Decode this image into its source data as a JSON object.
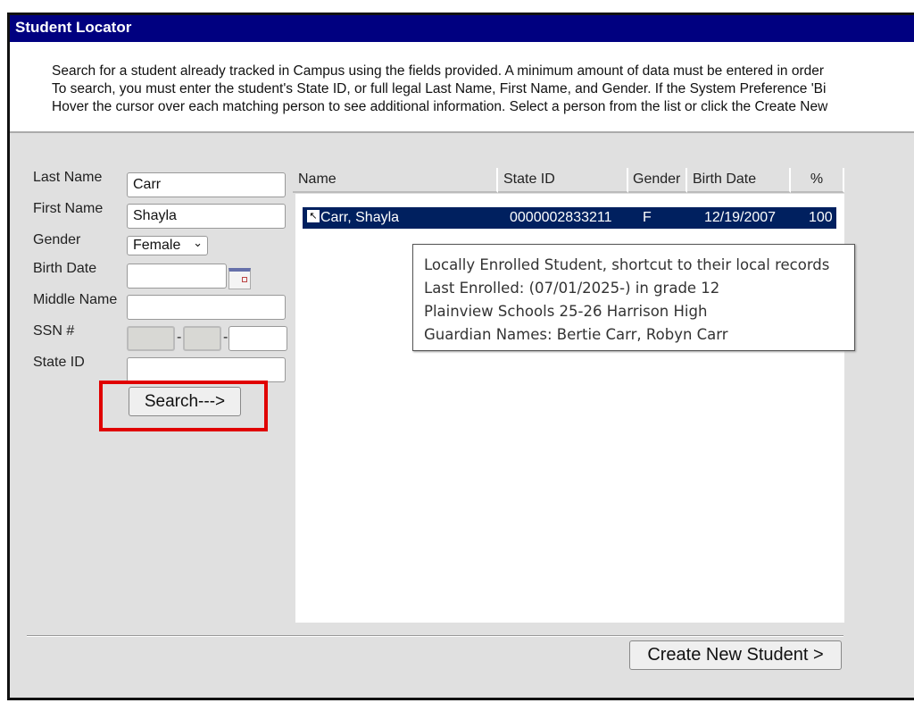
{
  "title": "Student Locator",
  "intro": [
    "Search for a student already tracked in Campus using the fields provided. A minimum amount of data must be entered in order",
    "To search, you must enter the student's State ID, or full legal Last Name, First Name, and Gender. If the System Preference 'Bi",
    "Hover the cursor over each matching person to see additional information. Select a person from the list or click the Create New"
  ],
  "form": {
    "last_name": {
      "label": "Last Name",
      "value": "Carr"
    },
    "first_name": {
      "label": "First Name",
      "value": "Shayla"
    },
    "gender": {
      "label": "Gender",
      "value": "Female"
    },
    "birth_date": {
      "label": "Birth Date",
      "value": ""
    },
    "middle_name": {
      "label": "Middle Name",
      "value": ""
    },
    "ssn": {
      "label": "SSN #",
      "sep": "-"
    },
    "state_id": {
      "label": "State ID",
      "value": ""
    },
    "search_label": "Search--->"
  },
  "results": {
    "columns": [
      "Name",
      "State ID",
      "Gender",
      "Birth Date",
      "%"
    ],
    "rows": [
      {
        "name": "Carr, Shayla",
        "state_id": "0000002833211",
        "gender": "F",
        "birth_date": "12/19/2007",
        "pct": "100",
        "icon": "local-shortcut-icon"
      }
    ]
  },
  "tooltip": [
    "Locally Enrolled Student, shortcut to their local records",
    "Last Enrolled: (07/01/2025-) in grade 12",
    "Plainview Schools  25-26 Harrison High",
    "Guardian Names: Bertie Carr, Robyn Carr"
  ],
  "create_label": "Create New Student >",
  "colors": {
    "title_bar": "#000080",
    "selected_row": "#00205f",
    "highlight": "#e00000"
  }
}
